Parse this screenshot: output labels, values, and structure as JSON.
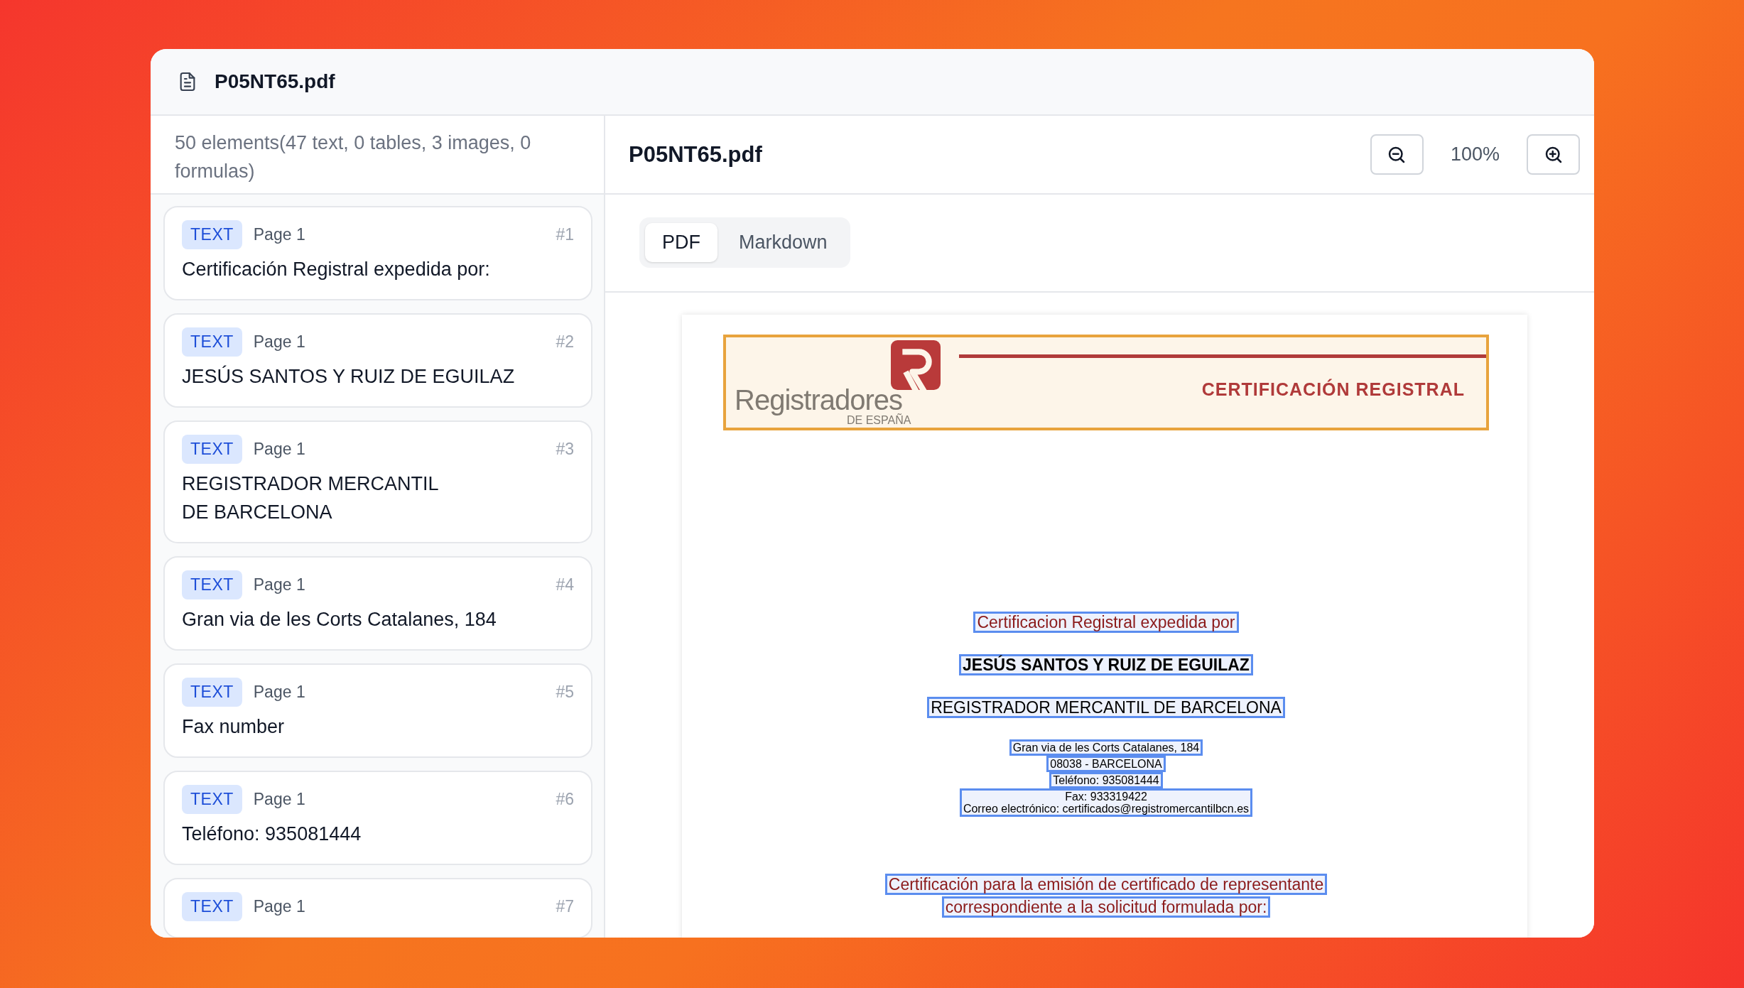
{
  "window": {
    "title": "P05NT65.pdf"
  },
  "sidebar": {
    "summary": "50 elements(47 text, 0 tables, 3 images, 0 formulas)",
    "items": [
      {
        "type": "TEXT",
        "page": "Page 1",
        "number": "#1",
        "text": "Certificación Registral expedida por:"
      },
      {
        "type": "TEXT",
        "page": "Page 1",
        "number": "#2",
        "text": "JESÚS SANTOS Y RUIZ DE EGUILAZ"
      },
      {
        "type": "TEXT",
        "page": "Page 1",
        "number": "#3",
        "text": "REGISTRADOR MERCANTIL\nDE BARCELONA"
      },
      {
        "type": "TEXT",
        "page": "Page 1",
        "number": "#4",
        "text": "Gran via de les Corts Catalanes, 184"
      },
      {
        "type": "TEXT",
        "page": "Page 1",
        "number": "#5",
        "text": "Fax number"
      },
      {
        "type": "TEXT",
        "page": "Page 1",
        "number": "#6",
        "text": "Teléfono: 935081444"
      },
      {
        "type": "TEXT",
        "page": "Page 1",
        "number": "#7"
      }
    ]
  },
  "viewer": {
    "title": "P05NT65.pdf",
    "zoom": "100%",
    "tabs": [
      {
        "label": "PDF",
        "selected": true
      },
      {
        "label": "Markdown",
        "selected": false
      }
    ],
    "page": {
      "logo_text": "Registradores",
      "logo_subtext": "DE ESPAÑA",
      "banner_title": "CERTIFICACIÓN REGISTRAL",
      "blocks": [
        {
          "kind": "red",
          "lines": [
            "Certificacion Registral expedida por"
          ]
        },
        {
          "kind": "bold",
          "lines": [
            "JESÚS SANTOS Y RUIZ DE EGUILAZ"
          ]
        },
        {
          "kind": "plain",
          "lines": [
            "REGISTRADOR MERCANTIL DE BARCELONA"
          ]
        },
        {
          "kind": "small",
          "lines": [
            "Gran via de les Corts Catalanes, 184"
          ]
        },
        {
          "kind": "small",
          "lines": [
            "08038 - BARCELONA"
          ]
        },
        {
          "kind": "small",
          "lines": [
            "Teléfono: 935081444"
          ]
        },
        {
          "kind": "small",
          "lines": [
            "Fax: 933319422",
            "Correo electrónico: certificados@registromercantilbcn.es"
          ]
        },
        {
          "kind": "red",
          "lines": [
            "Certificación para la emisión de certificado de representante"
          ]
        },
        {
          "kind": "red",
          "lines": [
            "correspondiente a la solicitud formulada por:"
          ]
        }
      ]
    }
  }
}
